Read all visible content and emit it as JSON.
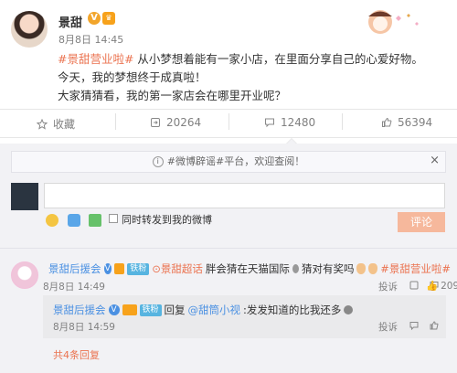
{
  "post": {
    "author": "景甜",
    "time": "8月8日 14:45",
    "lines": [
      {
        "hashtag": "#景甜营业啦#",
        "text": " 从小梦想着能有一家小店，在里面分享自己的心爱好物。"
      },
      {
        "text": "今天，我的梦想终于成真啦！"
      },
      {
        "text": "大家猜猜看，我的第一家店会在哪里开业呢？"
      }
    ]
  },
  "actions": {
    "favorite": "收藏",
    "repost": "20264",
    "comment": "12480",
    "like": "56394"
  },
  "notice": {
    "text": "#微博辟谣#平台，欢迎查阅！",
    "close": "×"
  },
  "compose": {
    "placeholder": "",
    "also_repost": "同时转发到我的微博",
    "submit": "评论"
  },
  "comment": {
    "author": "景甜后援会",
    "badge": "铁粉",
    "tag": "景甜超话",
    "text1": " 胖会猜在天猫国际",
    "text2": "  猜对有奖吗",
    "hashtag": "#景甜营业啦#",
    "time": "8月8日 14:49",
    "report": "投诉",
    "likes": "209"
  },
  "reply": {
    "author": "景甜后援会",
    "badge": "铁粉",
    "prefix": "回复",
    "mention": "@甜筒小视",
    "text": ":发发知道的比我还多",
    "time": "8月8日 14:59",
    "report": "投诉"
  },
  "more": {
    "text": "共4条回复"
  },
  "colors": {
    "link": "#eb7350",
    "submit_disabled": "#f6b89c",
    "gray_bg": "#f2f2f5"
  }
}
